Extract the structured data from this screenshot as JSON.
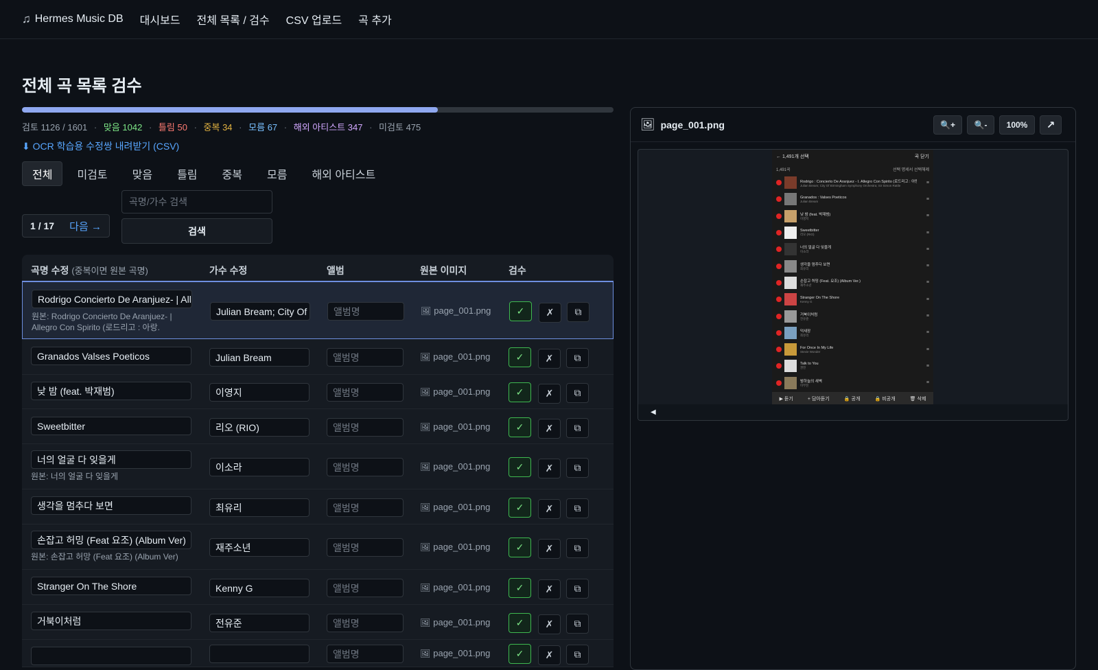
{
  "nav": {
    "brand": "Hermes Music DB",
    "links": [
      "대시보드",
      "전체 목록 / 검수",
      "CSV 업로드",
      "곡 추가"
    ]
  },
  "page": {
    "title": "전체 곡 목록 검수",
    "progress": 0.703
  },
  "stats": {
    "reviewed_label": "검토",
    "reviewed": "1126 / 1601",
    "ok_label": "맞음",
    "ok": "1042",
    "wrong_label": "틀림",
    "wrong": "50",
    "dup_label": "중복",
    "dup": "34",
    "unknown_label": "모름",
    "unknown": "67",
    "foreign_label": "해외 아티스트",
    "foreign": "347",
    "pending_label": "미검토",
    "pending": "475"
  },
  "download_label": "⬇ OCR 학습용 수정쌍 내려받기 (CSV)",
  "tabs": [
    "전체",
    "미검토",
    "맞음",
    "틀림",
    "중복",
    "모름",
    "해외 아티스트"
  ],
  "pager": {
    "page": "1 / 17",
    "next": "다음 →"
  },
  "search": {
    "placeholder": "곡명/가수 검색",
    "button": "검색"
  },
  "table": {
    "headers": {
      "title": "곡명 수정",
      "title_note": "(중복이면 원본 곡명)",
      "artist": "가수 수정",
      "album": "앨범",
      "image": "원본 이미지",
      "review": "검수"
    },
    "album_placeholder": "앨범명",
    "image_name": "page_001.png",
    "btn_ok": "✓",
    "btn_no": "✗",
    "btn_dup": "⧉",
    "rows": [
      {
        "title": "Rodrigo Concierto De Aranjuez- | Allegro Con Spirito",
        "artist": "Julian Bream; City Of",
        "orig": "원본: Rodrigo Concierto De Aranjuez- | Allegro Con Spirito (로드리고 : 아랑."
      },
      {
        "title": "Granados Valses Poeticos",
        "artist": "Julian Bream",
        "orig": ""
      },
      {
        "title": "낮 밤 (feat. 박재범)",
        "artist": "이영지",
        "orig": ""
      },
      {
        "title": "Sweetbitter",
        "artist": "리오 (RIO)",
        "orig": ""
      },
      {
        "title": "너의 얼굴 다 잊을게",
        "artist": "이소라",
        "orig": "원본: 너의 얼굴 다 잊을게"
      },
      {
        "title": "생각을 멈추다 보면",
        "artist": "최유리",
        "orig": ""
      },
      {
        "title": "손잡고 허밍 (Feat 요조) (Album Ver)",
        "artist": "재주소년",
        "orig": "원본: 손잡고 허망 (Feat 요조) (Album Ver)"
      },
      {
        "title": "Stranger On The Shore",
        "artist": "Kenny G",
        "orig": ""
      },
      {
        "title": "거북이처럼",
        "artist": "전유준",
        "orig": ""
      },
      {
        "title": "",
        "artist": "",
        "orig": ""
      }
    ]
  },
  "panel": {
    "title": "page_001.png",
    "zoom_in": "🔍+",
    "zoom_out": "🔍-",
    "zoom_level": "100%",
    "open": "↗",
    "foot_arrow": "◀"
  },
  "phone": {
    "header_left": "← 1,491개 선택",
    "header_right": "곡 닫기",
    "sub_left": "1,491곡",
    "sub_right": "선택  명세서  선택해제",
    "rows": [
      {
        "t": "Rodrigo : Concierto De Aranjuez - I. Allegro Con Spirito (로드리고 : 아랑...",
        "s": "Julian Bream; City Of Birmingham Symphony Orchestra; Sir Simon Rattle"
      },
      {
        "t": "Granados : Valses Poeticos",
        "s": "Julian Bream"
      },
      {
        "t": "낮 밤 (feat. 박재범)",
        "s": "이영지"
      },
      {
        "t": "Sweetbitter",
        "s": "리오 (RIO)"
      },
      {
        "t": "너의 얼굴 다 잊을게",
        "s": "이소라"
      },
      {
        "t": "생각을 멈추다 보면",
        "s": "최유리"
      },
      {
        "t": "손잡고 허밍 (Feat. 요조) (Album Ver.)",
        "s": "재주소년"
      },
      {
        "t": "Stranger On The Shore",
        "s": "Kenny G"
      },
      {
        "t": "거북이처럼",
        "s": "전유준"
      },
      {
        "t": "덕새장",
        "s": "최유리"
      },
      {
        "t": "For Once In My Life",
        "s": "Stevie Wonder"
      },
      {
        "t": "Talk to You",
        "s": "권진"
      },
      {
        "t": "밤하늘의 새벽",
        "s": "이무진"
      }
    ],
    "bar": [
      "▶ 듣기",
      "+ 담아듣기",
      "🔒 공개",
      "🔒 비공개",
      "🗑 삭제"
    ]
  }
}
